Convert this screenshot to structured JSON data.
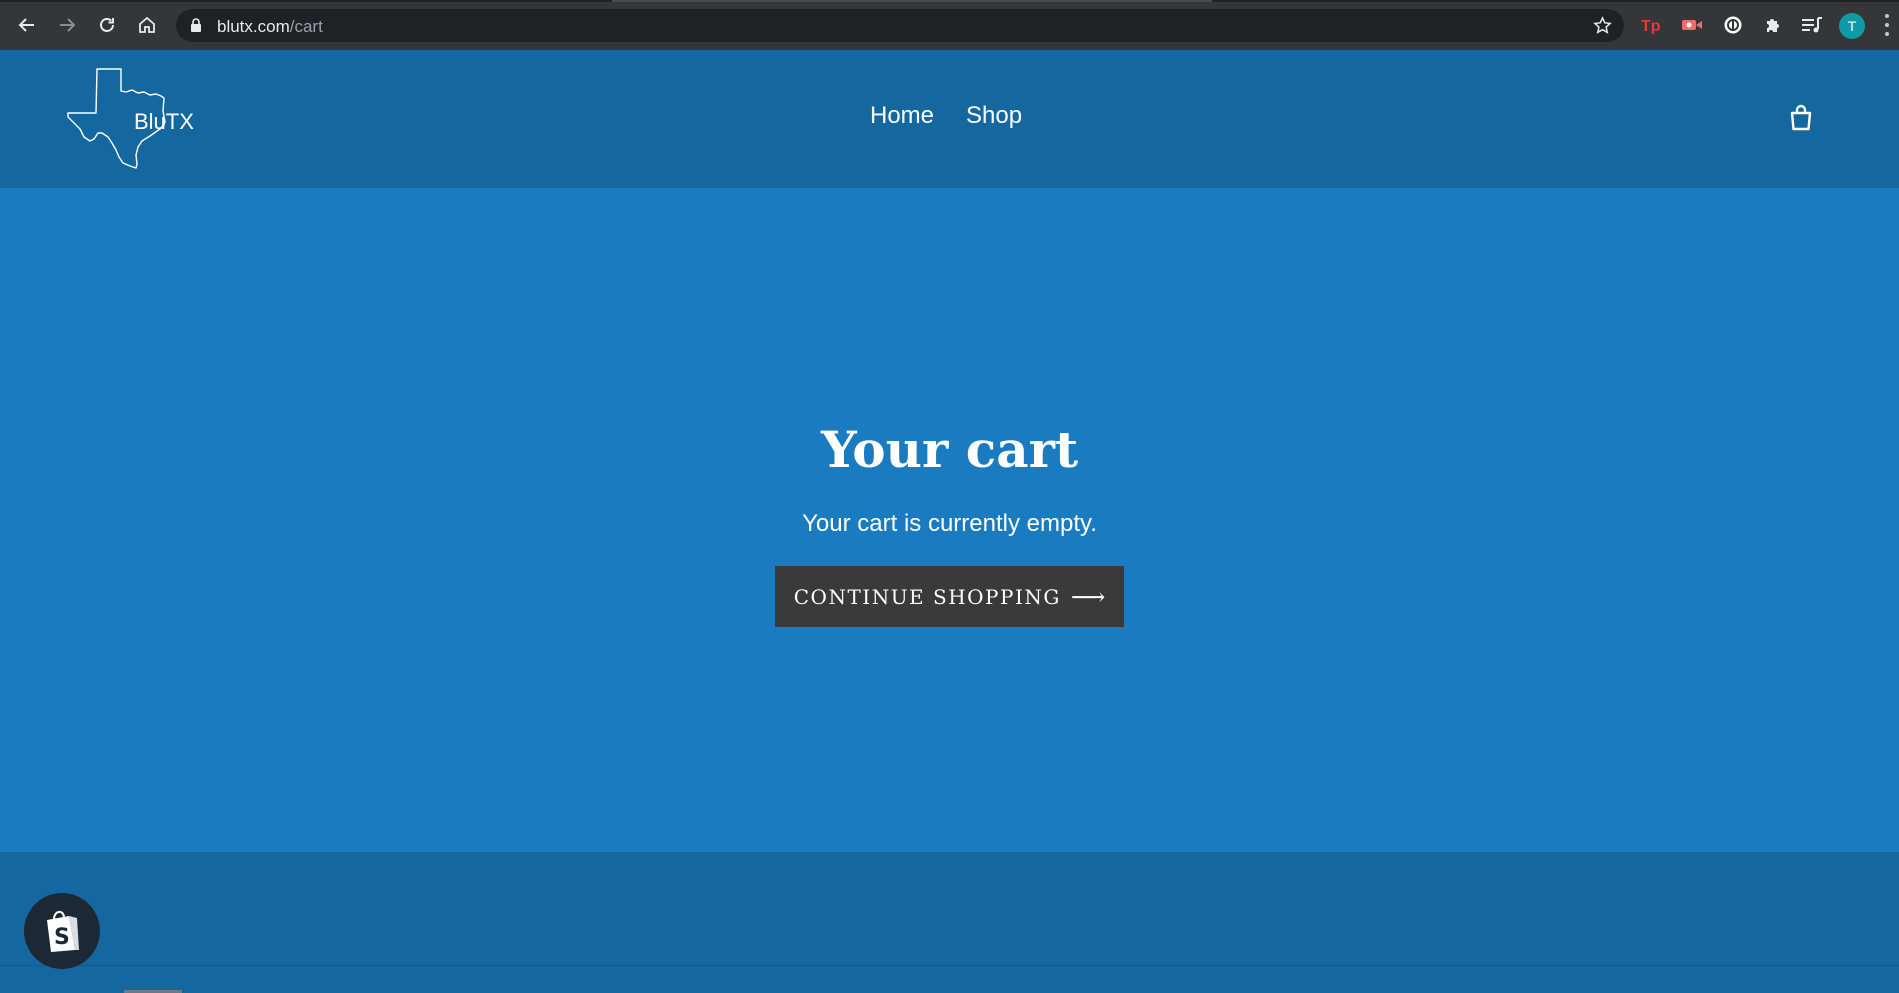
{
  "browser": {
    "url_domain": "blutx.com",
    "url_path": "/cart",
    "profile_initial": "T",
    "extensions": [
      "tp-extension-icon",
      "video-extension-icon",
      "circle-extension-icon",
      "puzzle-icon",
      "media-queue-icon"
    ]
  },
  "header": {
    "logo_text": "BluTX",
    "nav": [
      {
        "label": "Home"
      },
      {
        "label": "Shop"
      }
    ]
  },
  "main": {
    "title": "Your cart",
    "empty_message": "Your cart is currently empty.",
    "continue_button": "CONTINUE SHOPPING",
    "continue_arrow": "⟶"
  },
  "colors": {
    "header_bg": "#15689f",
    "main_bg": "#1b7bc0",
    "button_bg": "#3a3a3a"
  }
}
